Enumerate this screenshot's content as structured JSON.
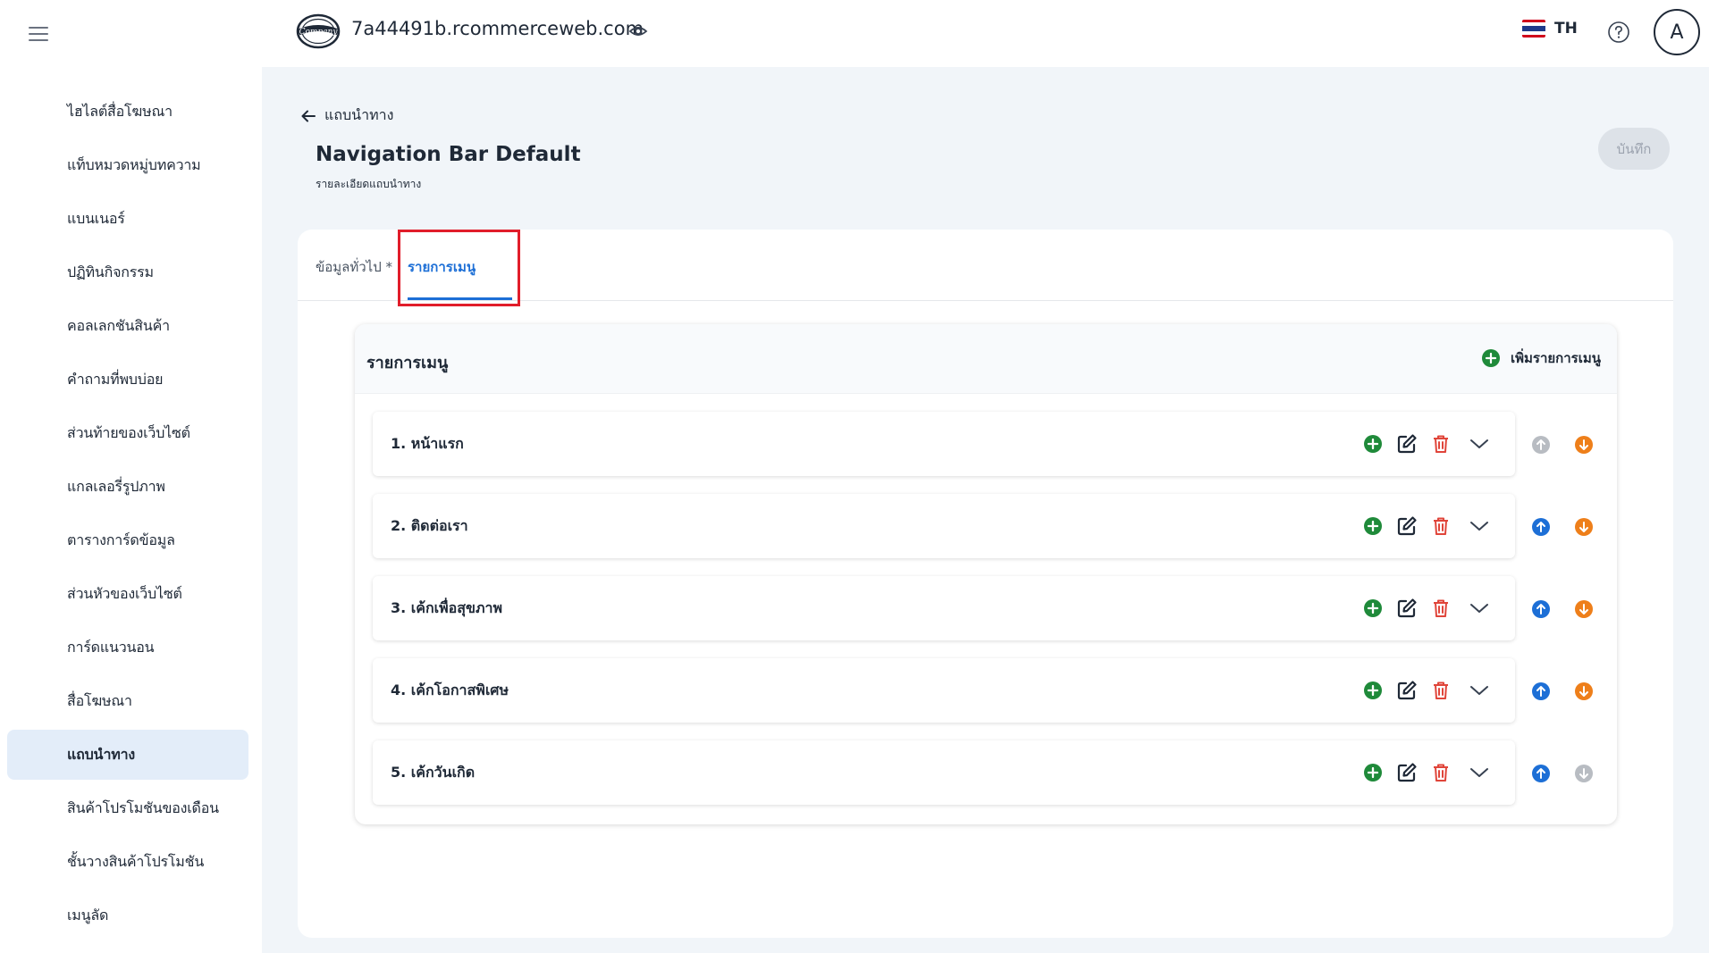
{
  "sidebar": {
    "items": [
      {
        "label": "ไฮไลต์สื่อโฆษณา"
      },
      {
        "label": "แท็บหมวดหมู่บทความ"
      },
      {
        "label": "แบนเนอร์"
      },
      {
        "label": "ปฏิทินกิจกรรม"
      },
      {
        "label": "คอลเลกชันสินค้า"
      },
      {
        "label": "คำถามที่พบบ่อย"
      },
      {
        "label": "ส่วนท้ายของเว็บไซต์"
      },
      {
        "label": "แกลเลอรี่รูปภาพ"
      },
      {
        "label": "ตารางการ์ดข้อมูล"
      },
      {
        "label": "ส่วนหัวของเว็บไซต์"
      },
      {
        "label": "การ์ดแนวนอน"
      },
      {
        "label": "สื่อโฆษณา"
      },
      {
        "label": "แถบนำทาง",
        "active": true
      },
      {
        "label": "สินค้าโปรโมชันของเดือน"
      },
      {
        "label": "ชั้นวางสินค้าโปรโมชัน"
      },
      {
        "label": "เมนูลัด"
      }
    ]
  },
  "header": {
    "domain": "7a44491b.rcommerceweb.com",
    "logo_text": "Company",
    "language": "TH",
    "avatar_letter": "A",
    "flag_colors": [
      "#d0021b",
      "#ffffff",
      "#1e3a8a",
      "#ffffff",
      "#d0021b"
    ]
  },
  "page": {
    "back_label": "แถบนำทาง",
    "title": "Navigation Bar Default",
    "subtitle": "รายละเอียดแถบนำทาง",
    "save_label": "บันทึก"
  },
  "tabs": {
    "general": "ข้อมูลทั่วไป *",
    "menu": "รายการเมนู"
  },
  "menu_panel": {
    "title": "รายการเมนู",
    "add_label": "เพิ่มรายการเมนู",
    "items": [
      {
        "label": "1. หน้าแรก",
        "up_enabled": false,
        "down_enabled": true
      },
      {
        "label": "2. ติดต่อเรา",
        "up_enabled": true,
        "down_enabled": true
      },
      {
        "label": "3. เค้กเพื่อสุขภาพ",
        "up_enabled": true,
        "down_enabled": true
      },
      {
        "label": "4. เค้กโอกาสพิเศษ",
        "up_enabled": true,
        "down_enabled": true
      },
      {
        "label": "5. เค้กวันเกิด",
        "up_enabled": true,
        "down_enabled": false
      }
    ]
  },
  "colors": {
    "accent": "#1d6fd6",
    "add_green": "#1f8a3a",
    "delete_red": "#e0453a",
    "down_orange": "#ee7f1a",
    "disabled_gray": "#b8bcc2",
    "highlight_red": "#e11d2a"
  }
}
